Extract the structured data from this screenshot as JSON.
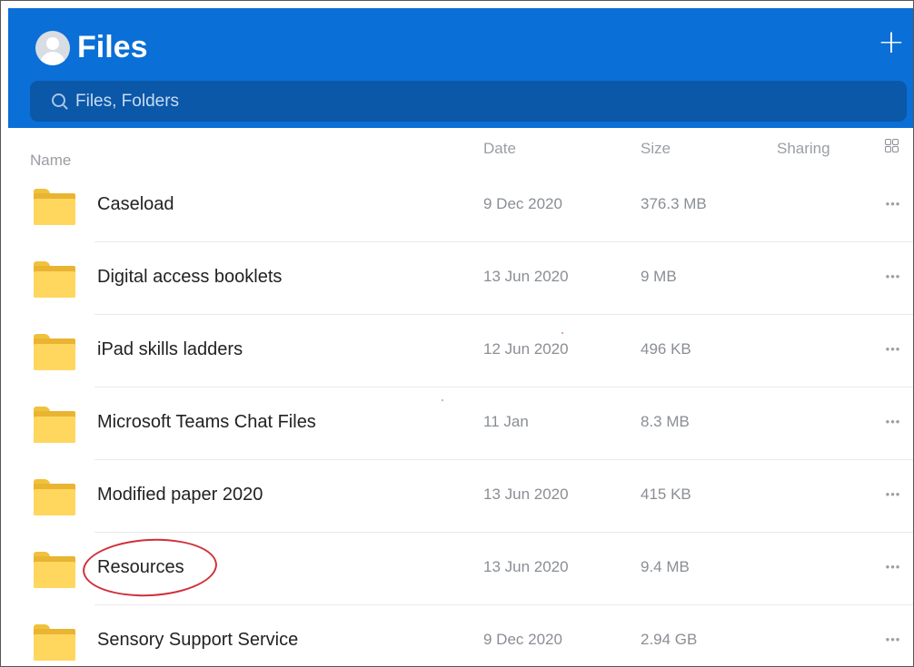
{
  "header": {
    "title": "Files",
    "add_icon": "plus-icon",
    "avatar_icon": "avatar-icon",
    "color": "#0a6fd6"
  },
  "search": {
    "placeholder": "Files, Folders",
    "icon": "search-icon"
  },
  "columns": {
    "name": "Name",
    "sort_indicator": "↑",
    "date": "Date",
    "size": "Size",
    "sharing": "Sharing",
    "view_icon": "grid-view-icon"
  },
  "rows": [
    {
      "name": "Caseload",
      "date": "9 Dec 2020",
      "size": "376.3 MB"
    },
    {
      "name": "Digital access booklets",
      "date": "13 Jun 2020",
      "size": "9 MB"
    },
    {
      "name": "iPad skills ladders",
      "date": "12 Jun 2020",
      "size": "496 KB"
    },
    {
      "name": "Microsoft Teams Chat Files",
      "date": "11 Jan",
      "size": "8.3 MB"
    },
    {
      "name": "Modified paper 2020",
      "date": "13 Jun 2020",
      "size": "415 KB"
    },
    {
      "name": "Resources",
      "date": "13 Jun 2020",
      "size": "9.4 MB"
    },
    {
      "name": "Sensory Support Service",
      "date": "9 Dec 2020",
      "size": "2.94 GB"
    }
  ],
  "row_more": "•••",
  "annotation": {
    "color": "#d0303a"
  }
}
